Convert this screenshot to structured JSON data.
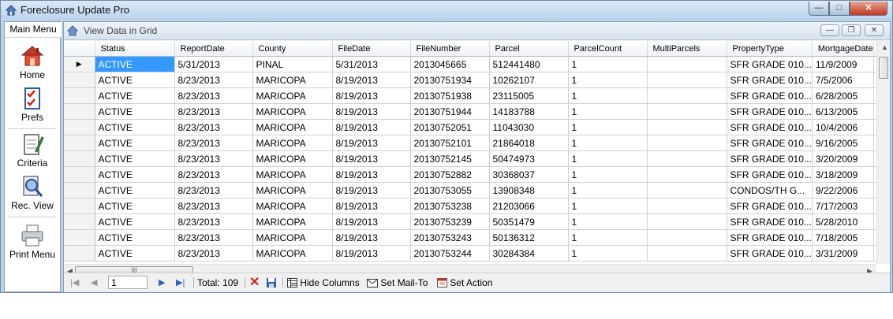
{
  "window": {
    "title": "Foreclosure Update Pro",
    "minimize": "—",
    "maximize": "□",
    "close": "✕"
  },
  "sidebar": {
    "tab": "Main Menu",
    "items": [
      {
        "label": "Home",
        "icon": "home-icon"
      },
      {
        "label": "Prefs",
        "icon": "checklist-icon"
      },
      {
        "label": "Criteria",
        "icon": "notepad-icon"
      },
      {
        "label": "Rec. View",
        "icon": "magnifier-icon"
      },
      {
        "label": "Print Menu",
        "icon": "printer-icon"
      }
    ]
  },
  "child_window": {
    "title": "View Data in Grid",
    "minimize": "—",
    "restore": "❐",
    "close": "✕"
  },
  "grid": {
    "columns": [
      "Status",
      "ReportDate",
      "County",
      "FileDate",
      "FileNumber",
      "Parcel",
      "ParcelCount",
      "MultiParcels",
      "PropertyType",
      "MortgageDate"
    ],
    "rows": [
      [
        "ACTIVE",
        "5/31/2013",
        "PINAL",
        "5/31/2013",
        "2013045665",
        "512441480",
        "1",
        "",
        "SFR GRADE 010...",
        "11/9/2009"
      ],
      [
        "ACTIVE",
        "8/23/2013",
        "MARICOPA",
        "8/19/2013",
        "20130751934",
        "10262107",
        "1",
        "",
        "SFR GRADE 010...",
        "7/5/2006"
      ],
      [
        "ACTIVE",
        "8/23/2013",
        "MARICOPA",
        "8/19/2013",
        "20130751938",
        "23115005",
        "1",
        "",
        "SFR GRADE 010...",
        "6/28/2005"
      ],
      [
        "ACTIVE",
        "8/23/2013",
        "MARICOPA",
        "8/19/2013",
        "20130751944",
        "14183788",
        "1",
        "",
        "SFR GRADE 010...",
        "6/13/2005"
      ],
      [
        "ACTIVE",
        "8/23/2013",
        "MARICOPA",
        "8/19/2013",
        "20130752051",
        "11043030",
        "1",
        "",
        "SFR GRADE 010...",
        "10/4/2006"
      ],
      [
        "ACTIVE",
        "8/23/2013",
        "MARICOPA",
        "8/19/2013",
        "20130752101",
        "21864018",
        "1",
        "",
        "SFR GRADE 010...",
        "9/16/2005"
      ],
      [
        "ACTIVE",
        "8/23/2013",
        "MARICOPA",
        "8/19/2013",
        "20130752145",
        "50474973",
        "1",
        "",
        "SFR GRADE 010...",
        "3/20/2009"
      ],
      [
        "ACTIVE",
        "8/23/2013",
        "MARICOPA",
        "8/19/2013",
        "20130752882",
        "30368037",
        "1",
        "",
        "SFR GRADE 010...",
        "3/18/2009"
      ],
      [
        "ACTIVE",
        "8/23/2013",
        "MARICOPA",
        "8/19/2013",
        "20130753055",
        "13908348",
        "1",
        "",
        "CONDOS/TH G...",
        "9/22/2006"
      ],
      [
        "ACTIVE",
        "8/23/2013",
        "MARICOPA",
        "8/19/2013",
        "20130753238",
        "21203066",
        "1",
        "",
        "SFR GRADE 010...",
        "7/17/2003"
      ],
      [
        "ACTIVE",
        "8/23/2013",
        "MARICOPA",
        "8/19/2013",
        "20130753239",
        "50351479",
        "1",
        "",
        "SFR GRADE 010...",
        "5/28/2010"
      ],
      [
        "ACTIVE",
        "8/23/2013",
        "MARICOPA",
        "8/19/2013",
        "20130753243",
        "50136312",
        "1",
        "",
        "SFR GRADE 010...",
        "7/18/2005"
      ],
      [
        "ACTIVE",
        "8/23/2013",
        "MARICOPA",
        "8/19/2013",
        "20130753244",
        "30284384",
        "1",
        "",
        "SFR GRADE 010...",
        "3/31/2009"
      ]
    ],
    "current_row_marker": "▶",
    "hscroll_grip": "III"
  },
  "navigator": {
    "position": "1",
    "total_label": "Total: 109",
    "hide_columns": "Hide Columns",
    "set_mail_to": "Set Mail-To",
    "set_action": "Set Action"
  },
  "colors": {
    "selection": "#3399ff",
    "delete_icon": "#d42020",
    "nav_arrow": "#2a62c9"
  }
}
